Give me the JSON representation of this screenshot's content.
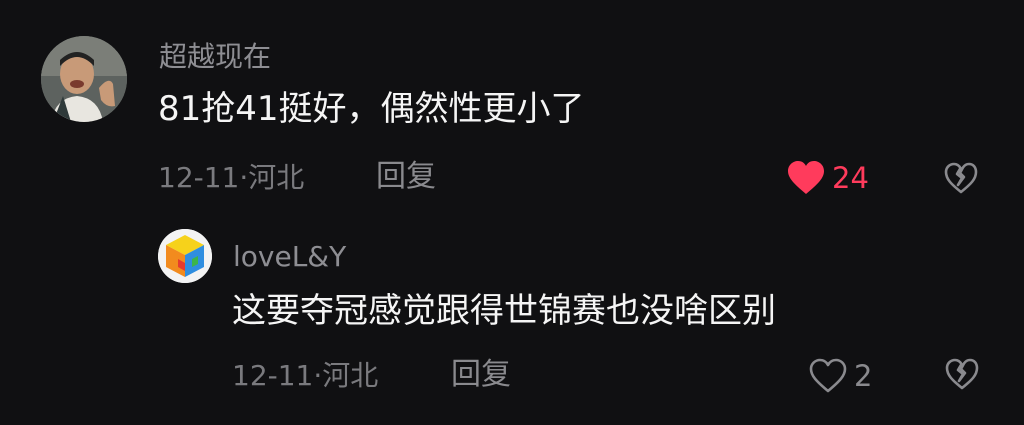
{
  "comments": [
    {
      "username": "超越现在",
      "text": "81抢41挺好，偶然性更小了",
      "date": "12-11·",
      "location": "河北",
      "reply_label": "回复",
      "like_count": "24",
      "liked": true
    },
    {
      "username": "loveL&Y",
      "text": "这要夺冠感觉跟得世锦赛也没啥区别",
      "date": "12-11·",
      "location": "河北",
      "reply_label": "回复",
      "like_count": "2",
      "liked": false
    }
  ],
  "colors": {
    "background": "#101012",
    "like_active": "#ff3b5c",
    "muted": "#8a8a8e"
  },
  "icons": {
    "like_active": "heart-filled-icon",
    "like_inactive": "heart-outline-icon",
    "dislike": "broken-heart-icon"
  }
}
